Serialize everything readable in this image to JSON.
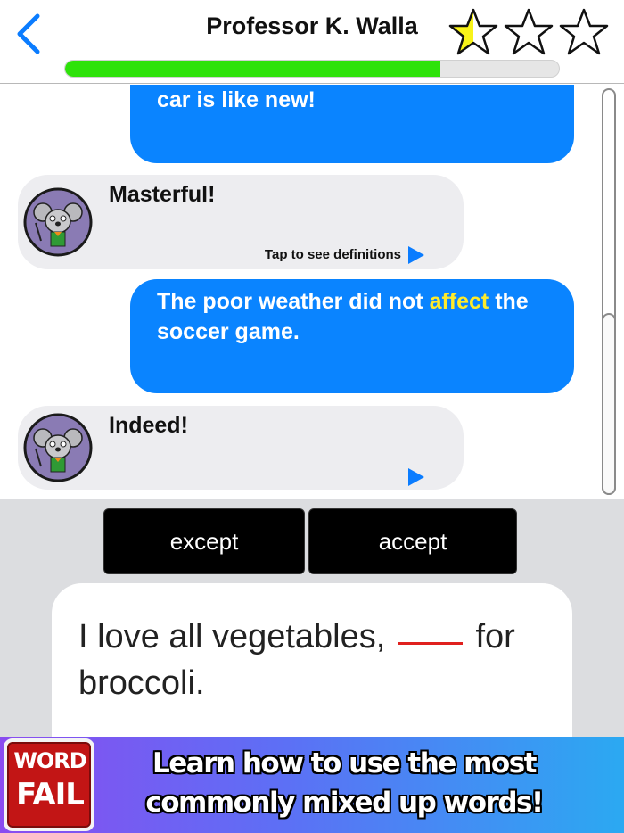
{
  "header": {
    "title": "Professor K. Walla",
    "stars_earned": 0.5,
    "stars_total": 3,
    "progress": 0.76
  },
  "chat": {
    "messages": [
      {
        "role": "user",
        "text": "car is like new!"
      },
      {
        "role": "bot",
        "text": "Masterful!",
        "hint": "Tap to see definitions"
      },
      {
        "role": "user",
        "text_before": "The poor weather did not ",
        "highlight": "affect",
        "text_after": " the soccer game."
      },
      {
        "role": "bot",
        "text": "Indeed!"
      }
    ]
  },
  "answers": {
    "options": [
      "except",
      "accept"
    ],
    "question_before": "I love all vegetables,",
    "question_after": "for broccoli."
  },
  "banner": {
    "logo_line1": "WORD",
    "logo_line2": "FAIL",
    "text": "Learn how to use the most commonly mixed up words!"
  },
  "colors": {
    "user_bubble": "#0a84ff",
    "bot_bubble": "#ededf0",
    "progress_fill": "#2ee20a",
    "highlight": "#ffeb2a",
    "blank_line": "#e0201e"
  }
}
